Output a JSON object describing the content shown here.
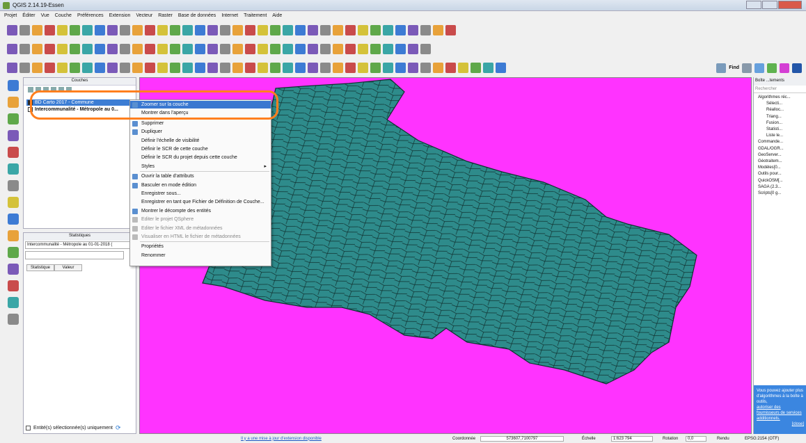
{
  "window": {
    "title": "QGIS 2.14.19-Essen"
  },
  "menubar": [
    "Projet",
    "Éditer",
    "Vue",
    "Couche",
    "Préférences",
    "Extension",
    "Vecteur",
    "Raster",
    "Base de données",
    "Internet",
    "Traitement",
    "Aide"
  ],
  "toolbar": {
    "find_label": "Find"
  },
  "layers_panel": {
    "title": "Couches",
    "layers": [
      {
        "name": "BD Carto 2017 - Commune",
        "selected": true,
        "checked": true
      },
      {
        "name": "Intercommunalité - Métropole au 0...",
        "selected": false,
        "checked": false
      }
    ]
  },
  "stats_panel": {
    "title": "Statistiques",
    "layer_value": "Intercommunalité - Métropole au 01-01-2018 (",
    "columns": [
      "Statistique",
      "Valeur"
    ],
    "footer_label": "Entité(s) sélectionnée(s) uniquement"
  },
  "context_menu": {
    "items": [
      {
        "label": "Zoomer sur la couche",
        "highlighted": true,
        "disabled": false,
        "icon": "zoom-icon"
      },
      {
        "label": "Montrer dans l'aperçu",
        "highlighted": false,
        "disabled": false,
        "icon": ""
      },
      {
        "label": "Supprimer",
        "highlighted": false,
        "disabled": false,
        "icon": "remove-icon"
      },
      {
        "label": "Dupliquer",
        "highlighted": false,
        "disabled": false,
        "icon": "duplicate-icon"
      },
      {
        "label": "Définir l'échelle de visibilité",
        "highlighted": false,
        "disabled": false,
        "icon": ""
      },
      {
        "label": "Définir le SCR de cette couche",
        "highlighted": false,
        "disabled": false,
        "icon": ""
      },
      {
        "label": "Définir le SCR du projet depuis cette couche",
        "highlighted": false,
        "disabled": false,
        "icon": ""
      },
      {
        "label": "Styles",
        "highlighted": false,
        "disabled": false,
        "icon": "",
        "submenu": true
      },
      {
        "label": "Ouvrir la table d'attributs",
        "highlighted": false,
        "disabled": false,
        "icon": "table-icon"
      },
      {
        "label": "Basculer en mode édition",
        "highlighted": false,
        "disabled": false,
        "icon": "pencil-icon"
      },
      {
        "label": "Enregistrer sous...",
        "highlighted": false,
        "disabled": false,
        "icon": ""
      },
      {
        "label": "Enregistrer en tant que Fichier de Définition de Couche...",
        "highlighted": false,
        "disabled": false,
        "icon": ""
      },
      {
        "label": "Montrer le décompte des entités",
        "highlighted": false,
        "disabled": false,
        "icon": "checkbox-icon"
      },
      {
        "label": "Editer le projet QSphere",
        "highlighted": false,
        "disabled": true,
        "icon": "qsphere-icon"
      },
      {
        "label": "Editer le fichier XML de métadonnées",
        "highlighted": false,
        "disabled": true,
        "icon": "xml-icon"
      },
      {
        "label": "Visualiser en HTML le fichier de métadonnées",
        "highlighted": false,
        "disabled": true,
        "icon": "html-icon"
      },
      {
        "label": "Propriétés",
        "highlighted": false,
        "disabled": false,
        "icon": ""
      },
      {
        "label": "Renommer",
        "highlighted": false,
        "disabled": false,
        "icon": ""
      }
    ]
  },
  "right_panel": {
    "title": "Boîte ...tements",
    "search_placeholder": "Rechercher",
    "tree": [
      "Algorithmes réc...",
      "Sélecti...",
      "Réalloc...",
      "Triang...",
      "Fusion...",
      "Statisti...",
      "Liste le...",
      "Commande...",
      "GDAL/OGR...",
      "GeoServer...",
      "Géotraitem...",
      "Modèles[0...",
      "Outils pour...",
      "QuickOSM[...",
      "SAGA (2.3...",
      "Scripts[0 g..."
    ],
    "info_text": "Vous pouvez ajouter plus d'algorithmes à la boîte à outils,",
    "info_link": "autoriser des fournisseurs de services additionnels.",
    "info_close": "[close]"
  },
  "statusbar": {
    "update_link": "Il y a une mise à jour d'extension disponible",
    "coord_label": "Coordonnée",
    "coord_value": "573607,7100797",
    "scale_label": "Échelle",
    "scale_value": "1:623 794",
    "rotation_label": "Rotation",
    "rotation_value": "0,0",
    "render_label": "Rendu",
    "crs_label": "EPSG:2154 (OTF)"
  },
  "colors": {
    "map_background": "#ff33ff",
    "polygon_fill": "#2e8b8b",
    "highlight": "#ff7f1e",
    "selection": "#3a78d0"
  }
}
